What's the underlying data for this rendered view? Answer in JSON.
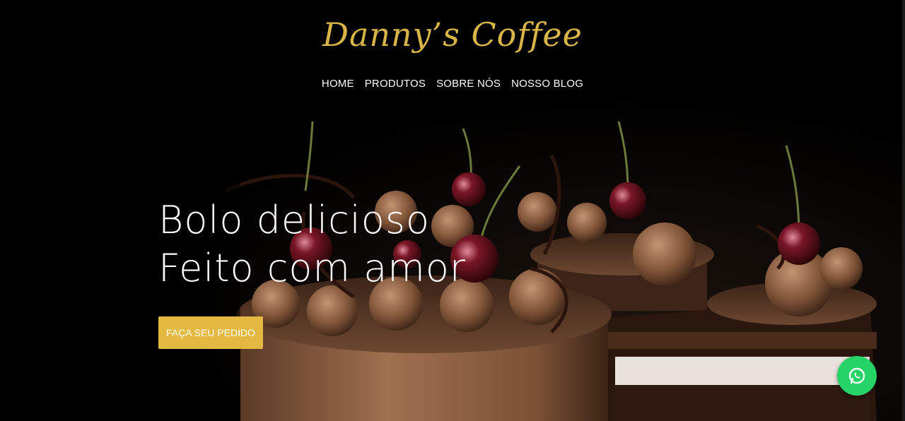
{
  "brand": {
    "title": "Danny’s Coffee"
  },
  "nav": {
    "items": [
      {
        "label": "HOME"
      },
      {
        "label": "PRODUTOS"
      },
      {
        "label": "SOBRE NÓS"
      },
      {
        "label": "NOSSO BLOG"
      }
    ]
  },
  "hero": {
    "line1": "Bolo delicioso",
    "line2": "Feito com amor",
    "cta_label": "FAÇA SEU PEDIDO",
    "image_subject": "chocolate-cherry-cake"
  },
  "floating": {
    "icon": "whatsapp-icon"
  },
  "colors": {
    "background": "#000000",
    "brand_gold": "#d9b547",
    "cta_gold": "#e3b941",
    "whatsapp_green": "#25d366",
    "text_white": "#ffffff"
  }
}
